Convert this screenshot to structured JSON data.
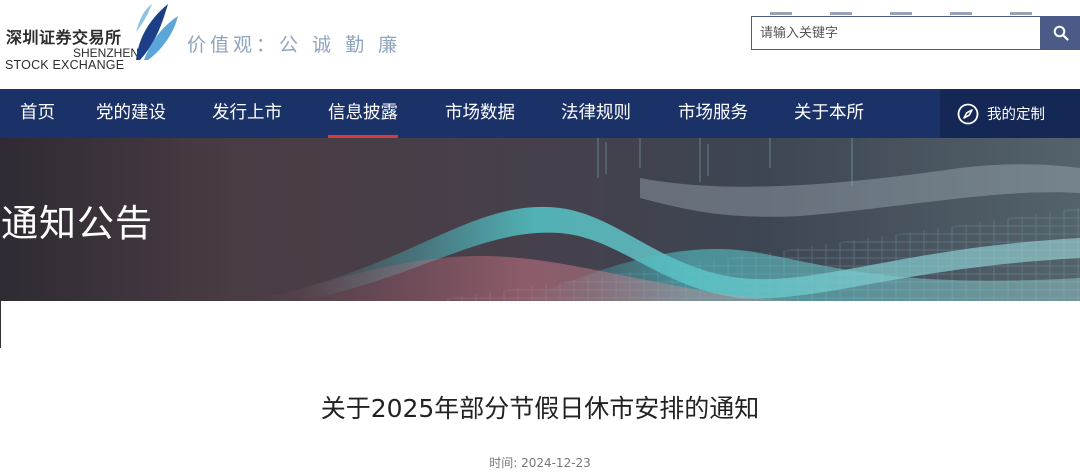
{
  "header": {
    "logo_cn": "深圳证券交易所",
    "logo_en_line1": "SHENZHEN",
    "logo_en_line2": "STOCK EXCHANGE",
    "slogan": "价值观：公 诚 勤 廉",
    "search": {
      "placeholder": "请输入关键字",
      "icon": "search-icon"
    }
  },
  "nav": {
    "items": [
      {
        "label": "首页",
        "active": false
      },
      {
        "label": "党的建设",
        "active": false
      },
      {
        "label": "发行上市",
        "active": false
      },
      {
        "label": "信息披露",
        "active": true
      },
      {
        "label": "市场数据",
        "active": false
      },
      {
        "label": "法律规则",
        "active": false
      },
      {
        "label": "市场服务",
        "active": false
      },
      {
        "label": "关于本所",
        "active": false
      }
    ],
    "custom": {
      "label": "我的定制",
      "icon": "compass-icon"
    }
  },
  "banner": {
    "title": "通知公告"
  },
  "article": {
    "title": "关于2025年部分节假日休市安排的通知",
    "meta_label": "时间:",
    "date": "2024-12-23"
  },
  "colors": {
    "nav_bg": "#1b3268",
    "nav_custom_bg": "#142755",
    "active_underline": "#d8393a",
    "search_button": "#4b5a86",
    "slogan": "#8fa4bd"
  }
}
